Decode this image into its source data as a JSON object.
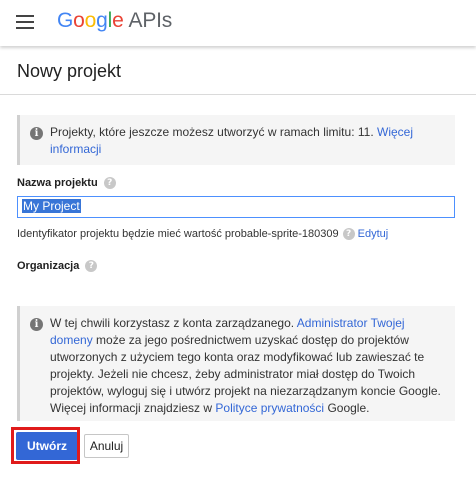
{
  "header": {
    "logo_google": [
      "G",
      "o",
      "o",
      "g",
      "l",
      "e"
    ],
    "logo_apis": "APIs"
  },
  "page": {
    "title": "Nowy projekt"
  },
  "quota_notice": {
    "text": "Projekty, które jeszcze możesz utworzyć w ramach limitu: 11.",
    "link": "Więcej informacji"
  },
  "form": {
    "name_label": "Nazwa projektu",
    "name_value": "My Project",
    "id_text": "Identyfikator projektu będzie mieć wartość probable-sprite-180309",
    "edit_link": "Edytuj",
    "org_label": "Organizacja"
  },
  "managed_notice": {
    "part1": "W tej chwili korzystasz z konta zarządzanego.",
    "link1": "Administrator Twojej domeny",
    "part2": "może za jego pośrednictwem uzyskać dostęp do projektów utworzonych z użyciem tego konta oraz modyfikować lub zawieszać te projekty. Jeżeli nie chcesz, żeby administrator miał dostęp do Twoich projektów, wyloguj się i utwórz projekt na niezarządzanym koncie Google. Więcej informacji znajdziesz w",
    "link2": "Polityce prywatności",
    "part3": "Google."
  },
  "buttons": {
    "create": "Utwórz",
    "cancel": "Anuluj"
  },
  "icons": {
    "info": "i",
    "help": "?"
  },
  "colors": {
    "accent": "#3367d6",
    "highlight": "#e01b1b",
    "input_selection": "#3875d7"
  }
}
